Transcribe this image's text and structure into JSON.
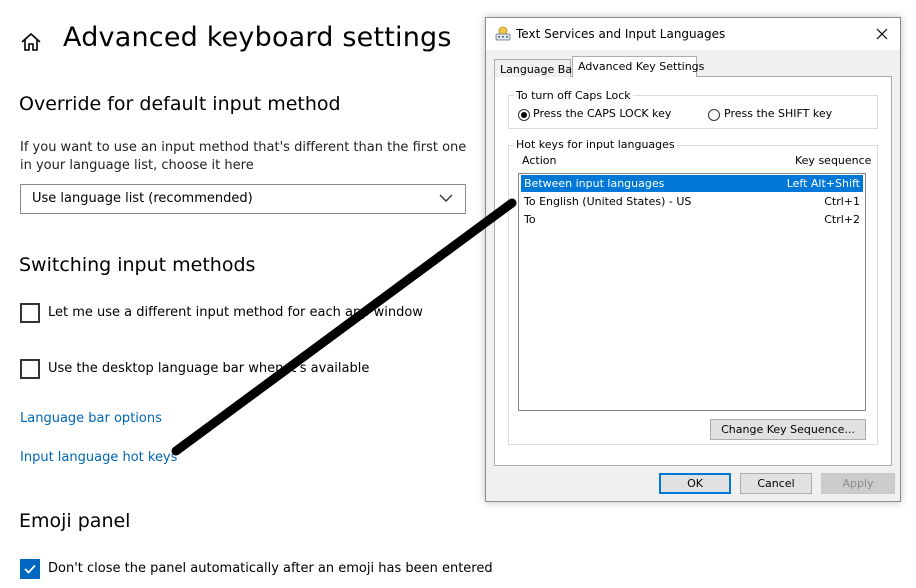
{
  "settings": {
    "title": "Advanced keyboard settings",
    "override": {
      "heading": "Override for default input method",
      "description": "If you want to use an input method that's different than the first one in your language list, choose it here",
      "dropdown_value": "Use language list (recommended)"
    },
    "switching": {
      "heading": "Switching input methods",
      "checkbox1_label": "Let me use a different input method for each app window",
      "checkbox1_checked": false,
      "checkbox2_label": "Use the desktop language bar when it's available",
      "checkbox2_checked": false,
      "link1": "Language bar options",
      "link2": "Input language hot keys"
    },
    "emoji": {
      "heading": "Emoji panel",
      "checkbox_label": "Don't close the panel automatically after an emoji has been entered",
      "checkbox_checked": true
    }
  },
  "dialog": {
    "title": "Text Services and Input Languages",
    "tabs": [
      {
        "label": "Language Bar",
        "active": false
      },
      {
        "label": "Advanced Key Settings",
        "active": true
      }
    ],
    "caps_lock": {
      "group_label": "To turn off Caps Lock",
      "option1": "Press the CAPS LOCK key",
      "option2": "Press the SHIFT key",
      "selected": "option1"
    },
    "hotkeys": {
      "group_label": "Hot keys for input languages",
      "col_action": "Action",
      "col_keys": "Key sequence",
      "rows": [
        {
          "action": "Between input languages",
          "keys": "Left Alt+Shift",
          "selected": true
        },
        {
          "action": "To English (United States) - US",
          "keys": "Ctrl+1",
          "selected": false
        },
        {
          "action": "To",
          "keys": "Ctrl+2",
          "selected": false
        }
      ],
      "change_button": "Change Key Sequence..."
    },
    "buttons": {
      "ok": "OK",
      "cancel": "Cancel",
      "apply": "Apply"
    }
  },
  "colors": {
    "accent": "#0067c0",
    "link": "#0067b8",
    "selection": "#0078d7"
  }
}
